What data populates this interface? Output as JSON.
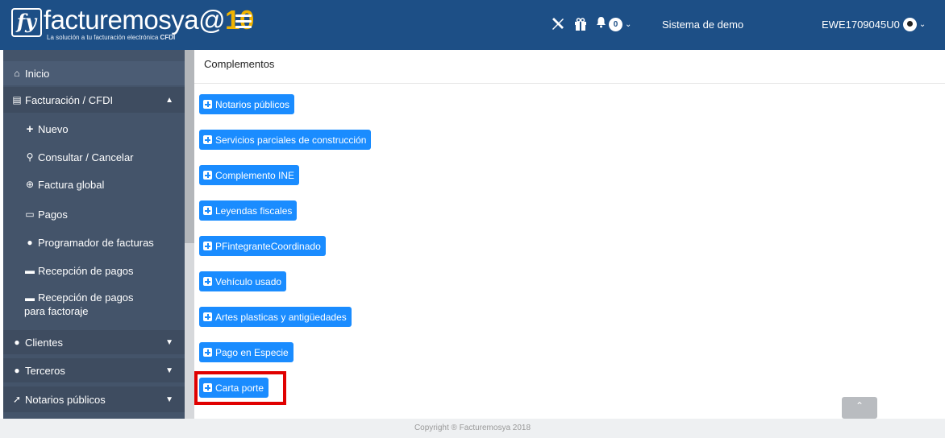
{
  "topbar": {
    "logo_mark": "fy",
    "logo_text": "facturemosya",
    "logo_at": "@",
    "logo_ten": "10",
    "logo_tagline": "La solución a tu facturación electrónica",
    "logo_tagline_bold": "CFDI",
    "notification_count": "0",
    "demo_label": "Sistema de demo",
    "user_label": "EWE1709045U0",
    "icons": [
      "hamburger-icon",
      "tools-icon",
      "gift-icon",
      "bell-icon",
      "user-circle-icon"
    ]
  },
  "sidebar": {
    "items": [
      {
        "label": "Inicio",
        "icon": "home-icon"
      },
      {
        "label": "Facturación / CFDI",
        "icon": "file-icon",
        "caret": "▲"
      },
      {
        "label": "Nuevo",
        "icon": "plus-icon"
      },
      {
        "label": "Consultar / Cancelar",
        "icon": "search-icon"
      },
      {
        "label": "Factura global",
        "icon": "globe-icon"
      },
      {
        "label": "Pagos",
        "icon": "money-icon"
      },
      {
        "label": "Programador de facturas",
        "icon": "user-clock-icon"
      },
      {
        "label": "Recepción de pagos",
        "icon": "card-icon"
      },
      {
        "label": "Recepción de pagos",
        "label2": "para factoraje",
        "icon": "card-icon"
      },
      {
        "label": "Clientes",
        "icon": "user-icon",
        "caret": "▼"
      },
      {
        "label": "Terceros",
        "icon": "users-icon",
        "caret": "▼"
      },
      {
        "label": "Notarios públicos",
        "icon": "gavel-icon",
        "caret": "▼"
      }
    ]
  },
  "main": {
    "title": "Complementos",
    "buttons": [
      "Notarios públicos",
      "Servicios parciales de construcción",
      "Complemento INE",
      "Leyendas fiscales",
      "PFintegranteCoordinado",
      "Vehículo usado",
      "Artes plasticas y antigüedades",
      "Pago en Especie",
      "Carta porte"
    ]
  },
  "footer": {
    "copyright": "Copyright ® Facturemosya 2018"
  },
  "colors": {
    "topbar": "#1d4f86",
    "sidebar": "#44546a",
    "button": "#1a8cff",
    "highlight": "#e00000"
  }
}
